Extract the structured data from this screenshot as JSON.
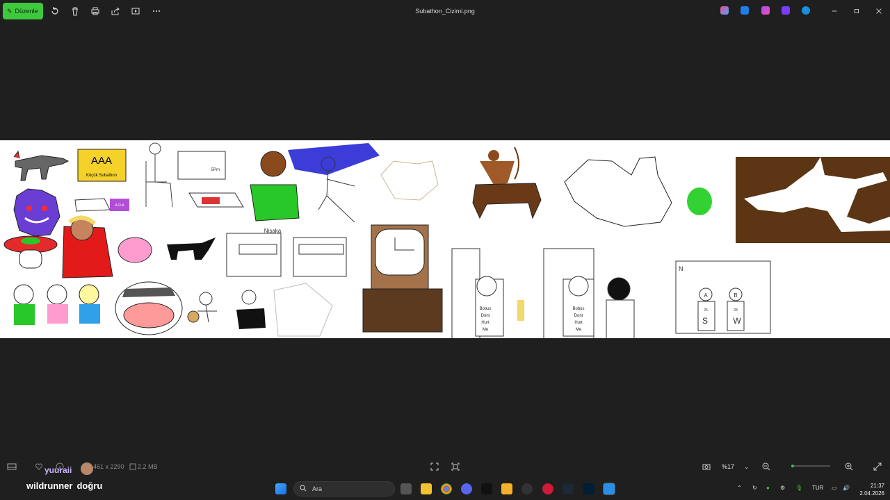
{
  "titlebar": {
    "edit_label": "Düzenle",
    "title": "Subathon_Cizimi.png",
    "icons": [
      "rotate-icon",
      "delete-icon",
      "print-icon",
      "share-icon",
      "slideshow-icon",
      "more-icon"
    ]
  },
  "drawing": {
    "sign_text": "AAA",
    "sign_subtext": "Küçük Subathon",
    "box_label": "A.D.A",
    "board_text": "5Pm",
    "building_label": "Nişaka",
    "shirt_text": [
      "Bobus",
      "Dont",
      "Hurt",
      "Me"
    ],
    "frame_letter": "N",
    "frame_letters": [
      "A",
      "B",
      "S",
      "W"
    ],
    "frame_numbers": [
      "25",
      "28"
    ]
  },
  "statusbar": {
    "dimensions": "461 x 2290",
    "filesize": "2.2 MB",
    "zoom": "%17"
  },
  "overlay": {
    "viewer_name": "yuuraii",
    "chat_user": "wildrunner",
    "chat_message": "doğru"
  },
  "taskbar": {
    "search_placeholder": "Ara",
    "lang": "TUR",
    "time": "21:37",
    "date": "2.04.2026"
  },
  "colors": {
    "accent": "#3ec83e",
    "background": "#1f1f1f",
    "canvas": "#ffffff"
  }
}
